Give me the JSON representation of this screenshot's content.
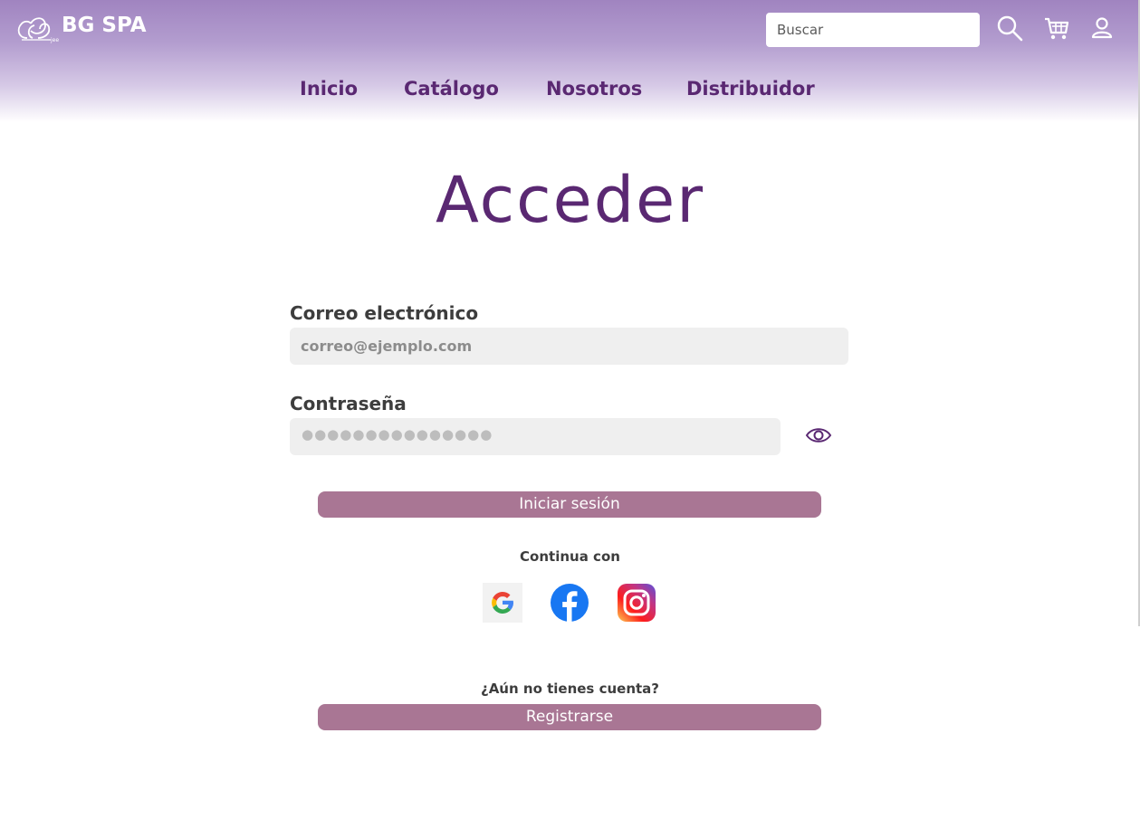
{
  "header": {
    "brand": "BG SPA",
    "search_placeholder": "Buscar",
    "icons": [
      "search-icon",
      "cart-icon",
      "user-icon"
    ]
  },
  "nav": {
    "items": [
      {
        "label": "Inicio"
      },
      {
        "label": "Catálogo"
      },
      {
        "label": "Nosotros"
      },
      {
        "label": "Distribuidor"
      }
    ]
  },
  "main": {
    "title": "Acceder",
    "email_label": "Correo electrónico",
    "email_placeholder": "correo@ejemplo.com",
    "password_label": "Contraseña",
    "password_placeholder": "●●●●●●●●●●●●●●●",
    "login_button": "Iniciar sesión",
    "continue_with": "Continua con",
    "social": [
      "google-icon",
      "facebook-icon",
      "instagram-icon"
    ],
    "no_account": "¿Aún no tienes cuenta?",
    "register_button": "Registrarse"
  },
  "colors": {
    "header_top": "#a084c0",
    "accent": "#5a2872",
    "button": "#a97694"
  }
}
